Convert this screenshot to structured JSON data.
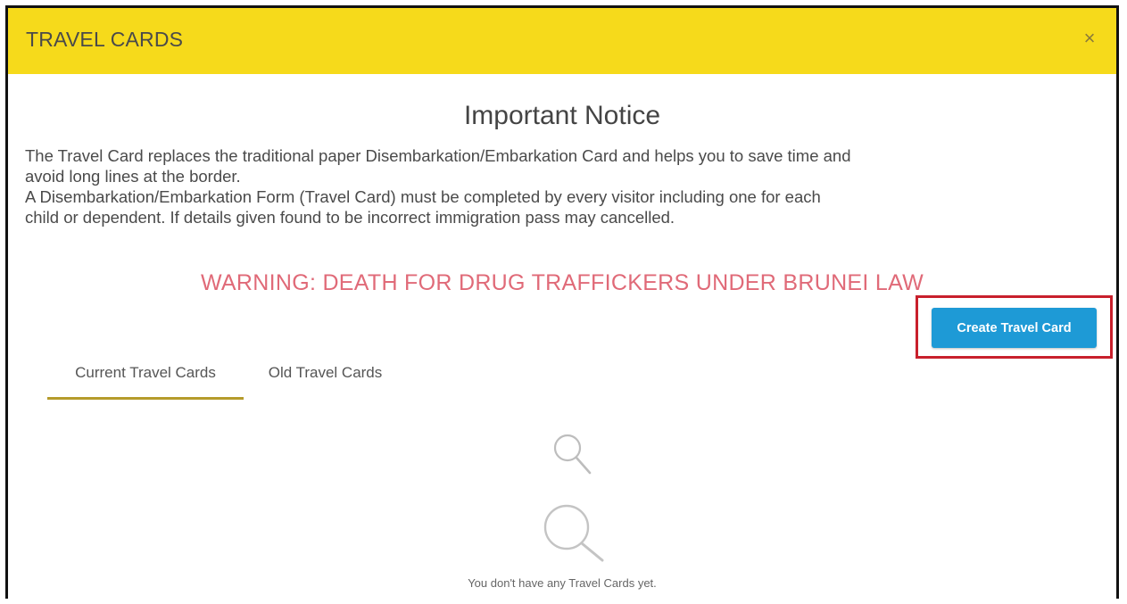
{
  "header": {
    "title": "TRAVEL CARDS",
    "close_glyph": "×"
  },
  "notice": {
    "title": "Important Notice",
    "line1": "The Travel Card replaces the traditional paper Disembarkation/Embarkation Card and helps you to save time and",
    "line2": "avoid long lines at the border.",
    "line3": "A Disembarkation/Embarkation Form (Travel Card) must be completed by every visitor including one for each",
    "line4": "child or dependent. If details given found to be incorrect immigration pass may cancelled.",
    "warning": "WARNING: DEATH FOR DRUG TRAFFICKERS UNDER BRUNEI LAW"
  },
  "actions": {
    "create_label": "Create Travel Card"
  },
  "tabs": [
    {
      "label": "Current Travel Cards",
      "active": true
    },
    {
      "label": "Old Travel Cards",
      "active": false
    }
  ],
  "empty_state": {
    "icon": "search-icon",
    "message": "You don't have any Travel Cards yet."
  },
  "colors": {
    "header_bg": "#f6da1b",
    "button_bg": "#1e9ad6",
    "warning_text": "#e06a78",
    "highlight_border": "#c8202c",
    "tab_underline": "#b59b2b"
  }
}
